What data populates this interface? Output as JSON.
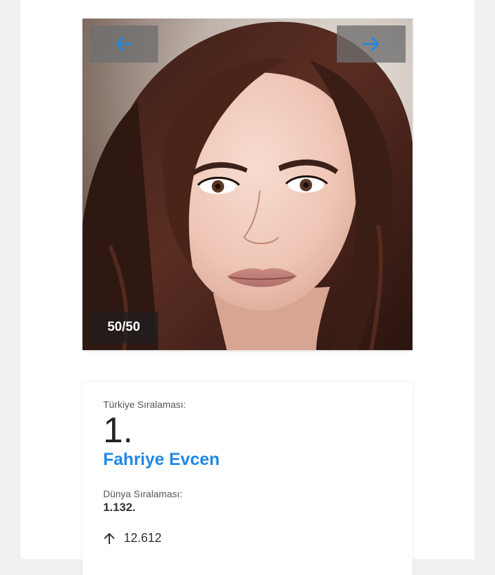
{
  "gallery": {
    "counter": "50/50",
    "prev_icon": "arrow-left-icon",
    "next_icon": "arrow-right-icon",
    "accent_color": "#1e88e5"
  },
  "profile": {
    "turkey_rank_label": "Türkiye Sıralaması:",
    "turkey_rank": "1.",
    "name": "Fahriye Evcen",
    "world_rank_label": "Dünya Sıralaması:",
    "world_rank": "1.132.",
    "trend_icon": "arrow-up-icon",
    "trend_value": "12.612"
  }
}
